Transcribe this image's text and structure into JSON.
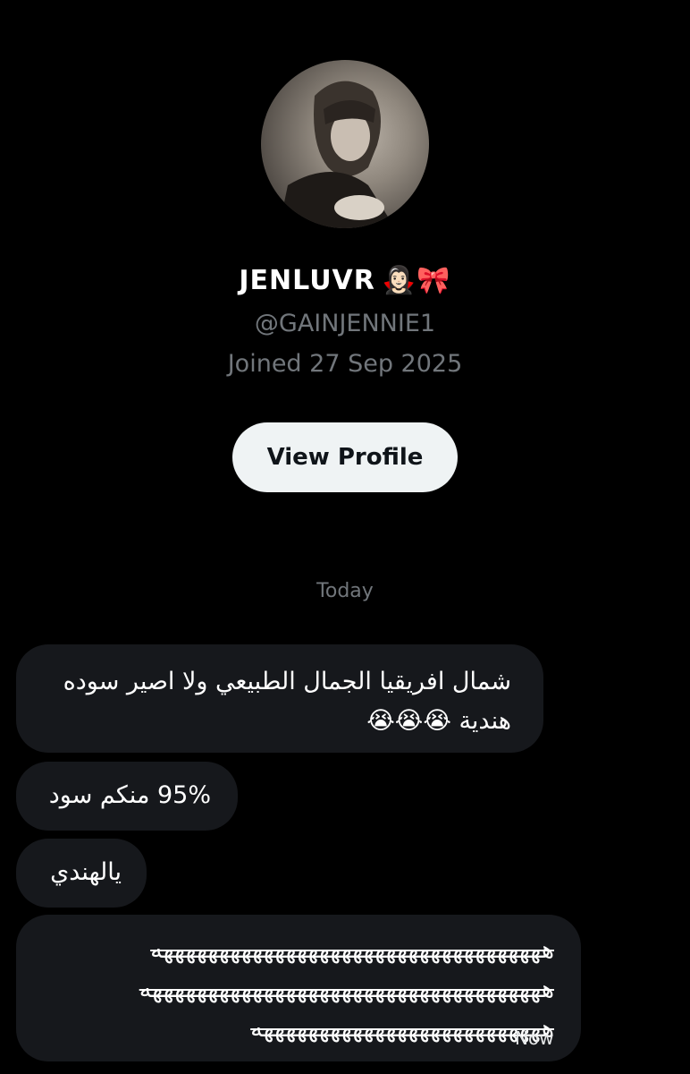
{
  "profile": {
    "display_name": "JENLUVR",
    "name_emoji": "🧛🏻‍♀️🎀",
    "handle": "@GAINJENNIE1",
    "joined": "Joined 27 Sep 2025",
    "view_profile_label": "View Profile",
    "avatar_icon": "profile-photo"
  },
  "conversation": {
    "date_separator": "Today",
    "messages": [
      {
        "line1": "شمال افريقيا الجمال الطبيعي ولا اصير سوده",
        "line2": "هندية 😭😭😭"
      },
      {
        "text": "95% منكم سود"
      },
      {
        "text": "يالهندي"
      },
      {
        "line1": "هههههههههههههههههههههههههههههههههههه",
        "line2": "ههههههههههههههههههههههههههههههههههههه",
        "line3": "ههههههههههههههههههههههههههه",
        "time": "Now"
      }
    ]
  },
  "colors": {
    "background": "#000000",
    "bubble": "#16181c",
    "muted": "#71767b",
    "button": "#eff3f4"
  }
}
